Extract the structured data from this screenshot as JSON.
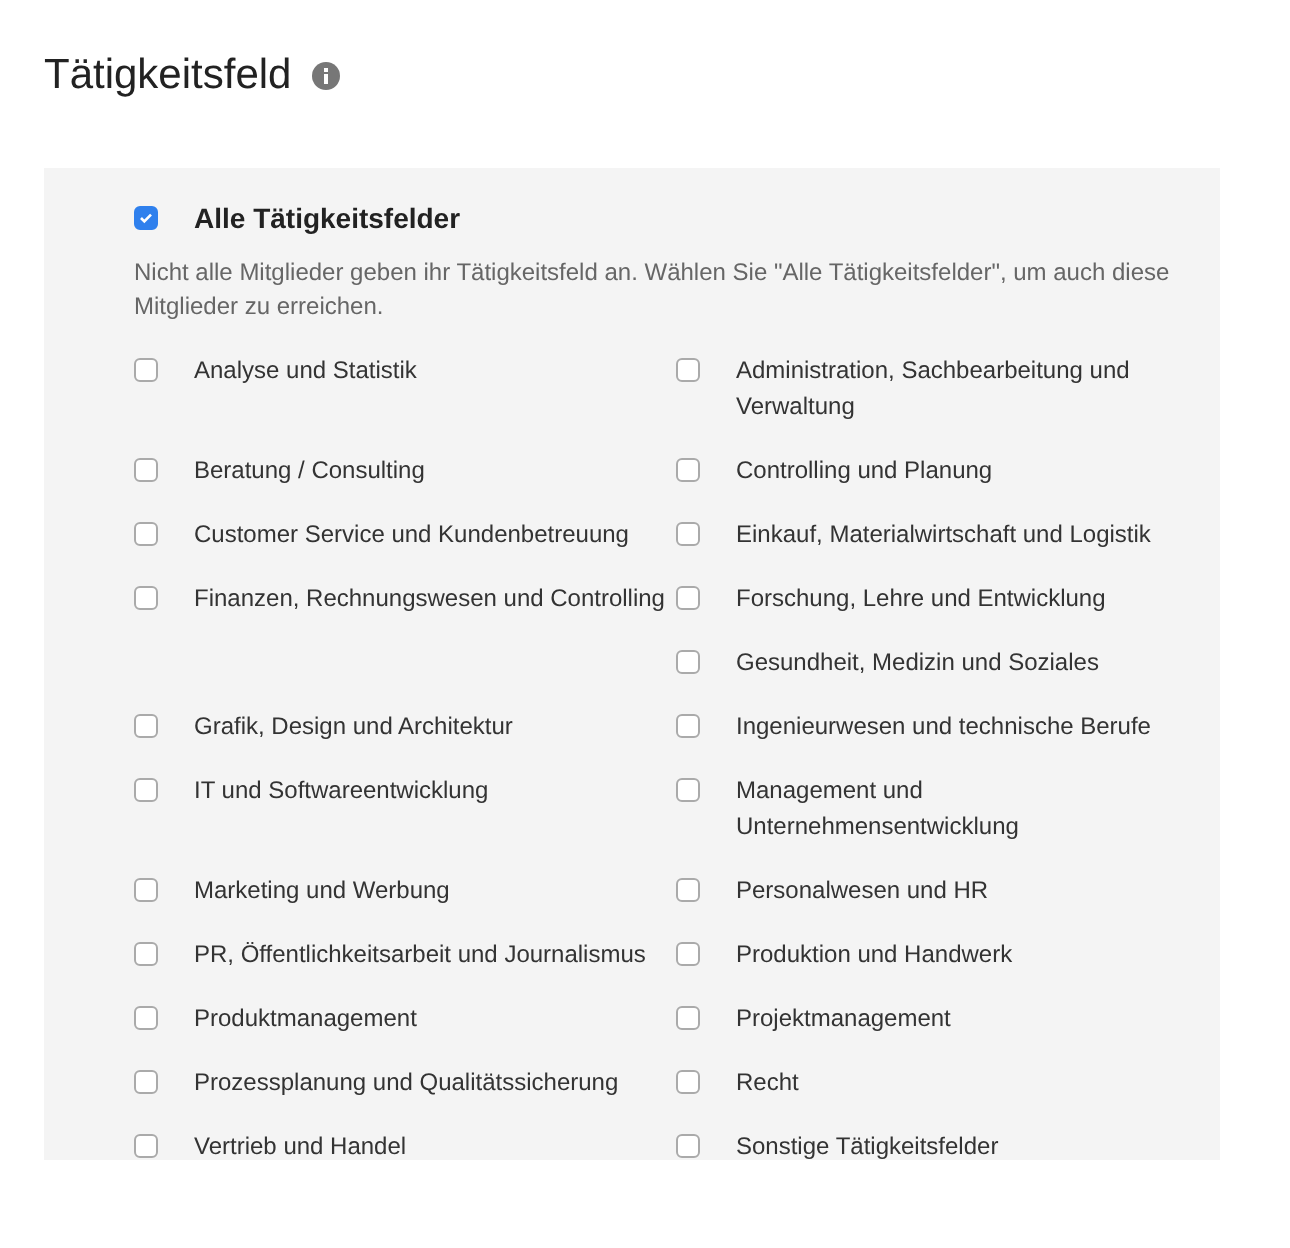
{
  "title": "Tätigkeitsfeld",
  "all": {
    "label": "Alle Tätigkeitsfelder",
    "checked": true
  },
  "note": "Nicht alle Mitglieder geben ihr Tätigkeitsfeld an. Wählen Sie \"Alle Tätigkeitsfelder\", um auch diese Mitglieder zu erreichen.",
  "rows": [
    {
      "left": {
        "label": "Analyse und Statistik",
        "checked": false
      },
      "right": {
        "label": "Administration, Sachbearbeitung und Verwaltung",
        "checked": false
      }
    },
    {
      "left": {
        "label": "Beratung / Consulting",
        "checked": false
      },
      "right": {
        "label": "Controlling und Planung",
        "checked": false
      }
    },
    {
      "left": {
        "label": "Customer Service und Kundenbetreuung",
        "checked": false
      },
      "right": {
        "label": "Einkauf, Materialwirtschaft und Logistik",
        "checked": false
      }
    },
    {
      "left": {
        "label": "Finanzen, Rechnungswesen und Controlling",
        "checked": false
      },
      "right": {
        "label": "Forschung, Lehre und Entwicklung",
        "checked": false
      }
    },
    {
      "right": {
        "label": "Gesundheit, Medizin und Soziales",
        "checked": false
      }
    },
    {
      "left": {
        "label": "Grafik, Design und Architektur",
        "checked": false
      },
      "right": {
        "label": "Ingenieurwesen und technische Berufe",
        "checked": false
      }
    },
    {
      "left": {
        "label": "IT und Softwareentwicklung",
        "checked": false
      },
      "right": {
        "label": "Management und Unternehmensentwicklung",
        "checked": false
      }
    },
    {
      "left": {
        "label": "Marketing und Werbung",
        "checked": false
      },
      "right": {
        "label": "Personalwesen und HR",
        "checked": false
      }
    },
    {
      "left": {
        "label": "PR, Öffentlichkeitsarbeit und Journalismus",
        "checked": false
      },
      "right": {
        "label": "Produktion und Handwerk",
        "checked": false
      }
    },
    {
      "left": {
        "label": "Produktmanagement",
        "checked": false
      },
      "right": {
        "label": "Projektmanagement",
        "checked": false
      }
    },
    {
      "left": {
        "label": "Prozessplanung und Qualitätssicherung",
        "checked": false
      },
      "right": {
        "label": "Recht",
        "checked": false
      }
    },
    {
      "left": {
        "label": "Vertrieb und Handel",
        "checked": false
      },
      "right": {
        "label": "Sonstige Tätigkeitsfelder",
        "checked": false
      }
    }
  ]
}
